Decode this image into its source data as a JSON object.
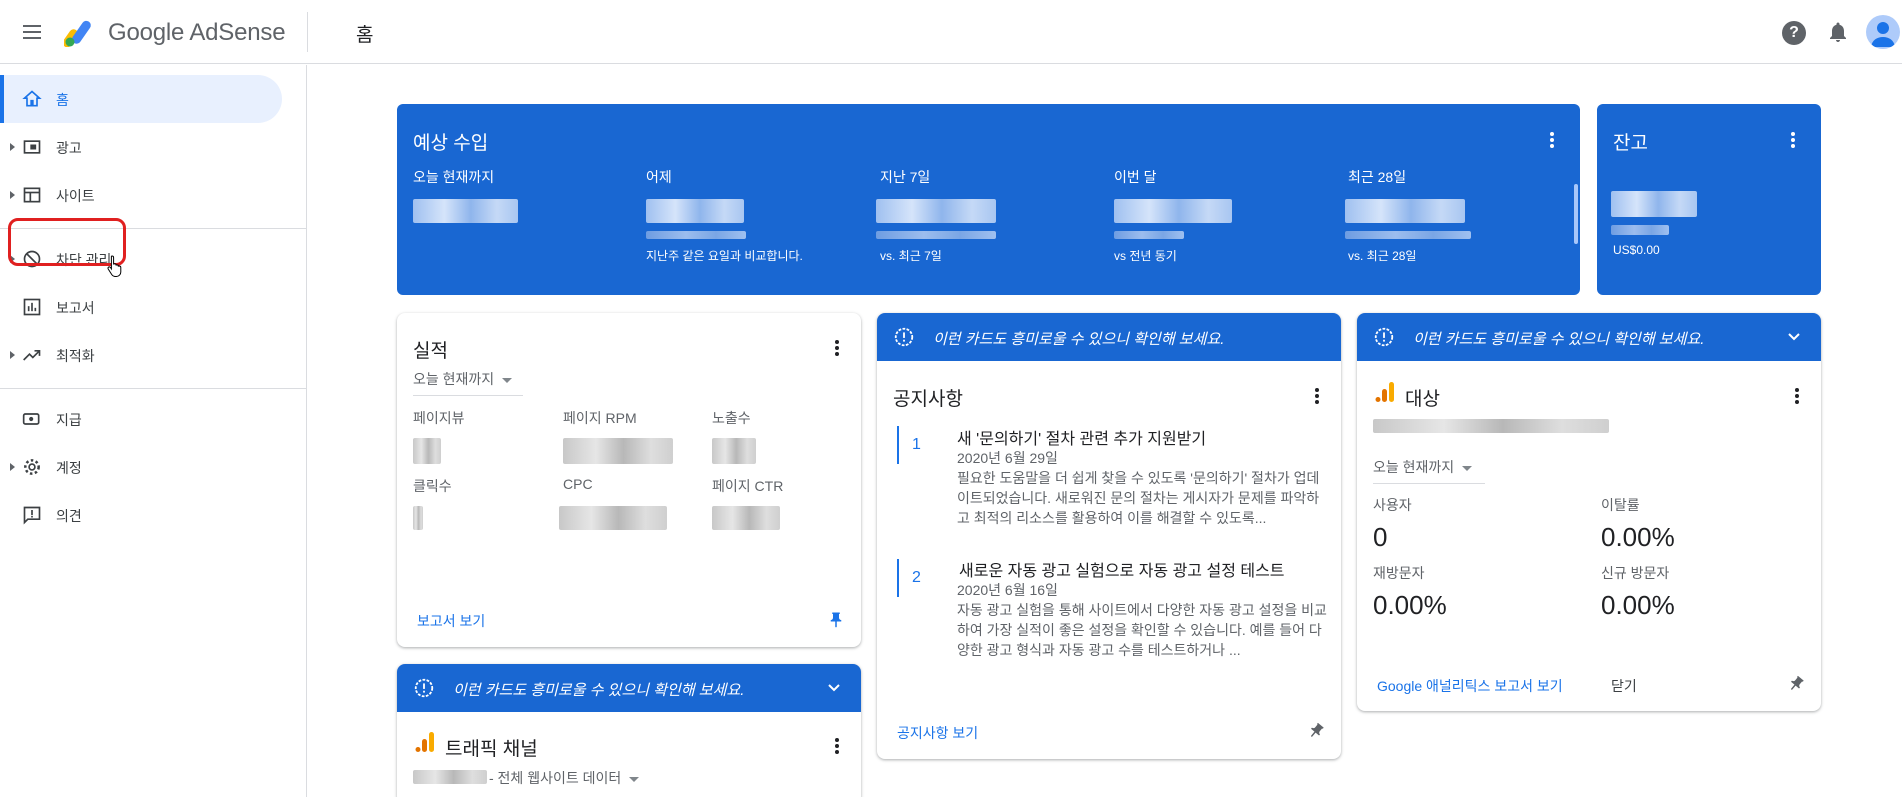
{
  "app": {
    "brand": "Google AdSense",
    "page_title": "홈"
  },
  "sidebar": {
    "items": [
      {
        "label": "홈",
        "icon": "home-icon",
        "active": true
      },
      {
        "label": "광고",
        "icon": "ads-icon"
      },
      {
        "label": "사이트",
        "icon": "sites-icon"
      },
      {
        "label": "차단 관리",
        "icon": "block-icon"
      },
      {
        "label": "보고서",
        "icon": "reports-icon"
      },
      {
        "label": "최적화",
        "icon": "optimize-icon"
      },
      {
        "label": "지급",
        "icon": "payments-icon"
      },
      {
        "label": "계정",
        "icon": "settings-icon"
      },
      {
        "label": "의견",
        "icon": "feedback-icon"
      }
    ]
  },
  "estimated_earnings": {
    "title": "예상 수입",
    "columns": [
      {
        "label": "오늘 현재까지",
        "sub": ""
      },
      {
        "label": "어제",
        "sub": "지난주 같은 요일과 비교합니다."
      },
      {
        "label": "지난 7일",
        "sub": "vs. 최근 7일"
      },
      {
        "label": "이번 달",
        "sub": "vs 전년 동기"
      },
      {
        "label": "최근 28일",
        "sub": "vs. 최근 28일"
      }
    ]
  },
  "balance": {
    "title": "잔고",
    "sub": "US$0.00"
  },
  "performance": {
    "title": "실적",
    "range": "오늘 현재까지",
    "metrics": [
      "페이지뷰",
      "페이지 RPM",
      "노출수",
      "클릭수",
      "CPC",
      "페이지 CTR"
    ],
    "link": "보고서 보기"
  },
  "suggestion_banner": "이런 카드도 흥미로울 수 있으니 확인해 보세요.",
  "announcements": {
    "title": "공지사항",
    "items": [
      {
        "num": "1",
        "title": "새 '문의하기' 절차 관련 추가 지원받기",
        "date": "2020년 6월 29일",
        "body": "필요한 도움말을 더 쉽게 찾을 수 있도록 '문의하기' 절차가 업데이트되었습니다. 새로워진 문의 절차는 게시자가 문제를 파악하고 최적의 리소스를 활용하여 이를 해결할 수 있도록..."
      },
      {
        "num": "2",
        "title": "새로운 자동 광고 실험으로 자동 광고 설정 테스트",
        "date": "2020년 6월 16일",
        "body": "자동 광고 실험을 통해 사이트에서 다양한 자동 광고 설정을 비교하여 가장 실적이 좋은 설정을 확인할 수 있습니다. 예를 들어 다양한 광고 형식과 자동 광고 수를 테스트하거나 ..."
      }
    ],
    "link": "공지사항 보기"
  },
  "audience": {
    "title": "대상",
    "range": "오늘 현재까지",
    "stats": [
      {
        "label": "사용자",
        "value": "0"
      },
      {
        "label": "이탈률",
        "value": "0.00%"
      },
      {
        "label": "재방문자",
        "value": "0.00%"
      },
      {
        "label": "신규 방문자",
        "value": "0.00%"
      }
    ],
    "link": "Google 애널리틱스 보고서 보기",
    "dismiss": "닫기"
  },
  "traffic": {
    "title": "트래픽 채널",
    "scope": "- 전체 웹사이트 데이터"
  },
  "colors": {
    "primary_blue": "#1967d2",
    "link_blue": "#1a73e8",
    "analytics_orange": "#f9ab00",
    "highlight_red": "#e02020"
  }
}
